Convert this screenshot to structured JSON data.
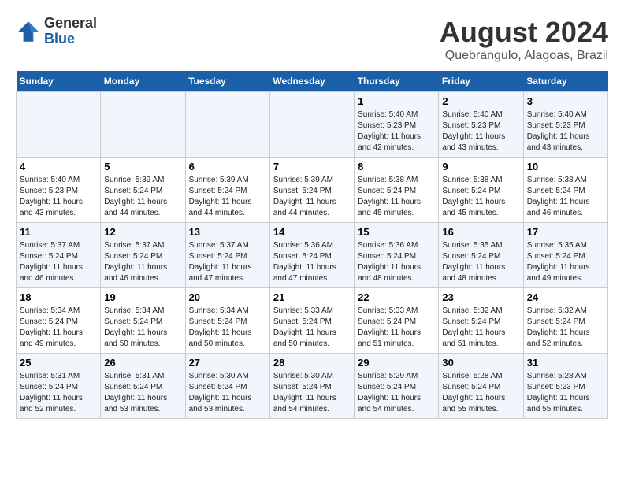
{
  "logo": {
    "general": "General",
    "blue": "Blue"
  },
  "title": "August 2024",
  "subtitle": "Quebrangulo, Alagoas, Brazil",
  "days_of_week": [
    "Sunday",
    "Monday",
    "Tuesday",
    "Wednesday",
    "Thursday",
    "Friday",
    "Saturday"
  ],
  "weeks": [
    [
      {
        "day": "",
        "info": ""
      },
      {
        "day": "",
        "info": ""
      },
      {
        "day": "",
        "info": ""
      },
      {
        "day": "",
        "info": ""
      },
      {
        "day": "1",
        "info": "Sunrise: 5:40 AM\nSunset: 5:23 PM\nDaylight: 11 hours\nand 42 minutes."
      },
      {
        "day": "2",
        "info": "Sunrise: 5:40 AM\nSunset: 5:23 PM\nDaylight: 11 hours\nand 43 minutes."
      },
      {
        "day": "3",
        "info": "Sunrise: 5:40 AM\nSunset: 5:23 PM\nDaylight: 11 hours\nand 43 minutes."
      }
    ],
    [
      {
        "day": "4",
        "info": "Sunrise: 5:40 AM\nSunset: 5:23 PM\nDaylight: 11 hours\nand 43 minutes."
      },
      {
        "day": "5",
        "info": "Sunrise: 5:39 AM\nSunset: 5:24 PM\nDaylight: 11 hours\nand 44 minutes."
      },
      {
        "day": "6",
        "info": "Sunrise: 5:39 AM\nSunset: 5:24 PM\nDaylight: 11 hours\nand 44 minutes."
      },
      {
        "day": "7",
        "info": "Sunrise: 5:39 AM\nSunset: 5:24 PM\nDaylight: 11 hours\nand 44 minutes."
      },
      {
        "day": "8",
        "info": "Sunrise: 5:38 AM\nSunset: 5:24 PM\nDaylight: 11 hours\nand 45 minutes."
      },
      {
        "day": "9",
        "info": "Sunrise: 5:38 AM\nSunset: 5:24 PM\nDaylight: 11 hours\nand 45 minutes."
      },
      {
        "day": "10",
        "info": "Sunrise: 5:38 AM\nSunset: 5:24 PM\nDaylight: 11 hours\nand 46 minutes."
      }
    ],
    [
      {
        "day": "11",
        "info": "Sunrise: 5:37 AM\nSunset: 5:24 PM\nDaylight: 11 hours\nand 46 minutes."
      },
      {
        "day": "12",
        "info": "Sunrise: 5:37 AM\nSunset: 5:24 PM\nDaylight: 11 hours\nand 46 minutes."
      },
      {
        "day": "13",
        "info": "Sunrise: 5:37 AM\nSunset: 5:24 PM\nDaylight: 11 hours\nand 47 minutes."
      },
      {
        "day": "14",
        "info": "Sunrise: 5:36 AM\nSunset: 5:24 PM\nDaylight: 11 hours\nand 47 minutes."
      },
      {
        "day": "15",
        "info": "Sunrise: 5:36 AM\nSunset: 5:24 PM\nDaylight: 11 hours\nand 48 minutes."
      },
      {
        "day": "16",
        "info": "Sunrise: 5:35 AM\nSunset: 5:24 PM\nDaylight: 11 hours\nand 48 minutes."
      },
      {
        "day": "17",
        "info": "Sunrise: 5:35 AM\nSunset: 5:24 PM\nDaylight: 11 hours\nand 49 minutes."
      }
    ],
    [
      {
        "day": "18",
        "info": "Sunrise: 5:34 AM\nSunset: 5:24 PM\nDaylight: 11 hours\nand 49 minutes."
      },
      {
        "day": "19",
        "info": "Sunrise: 5:34 AM\nSunset: 5:24 PM\nDaylight: 11 hours\nand 50 minutes."
      },
      {
        "day": "20",
        "info": "Sunrise: 5:34 AM\nSunset: 5:24 PM\nDaylight: 11 hours\nand 50 minutes."
      },
      {
        "day": "21",
        "info": "Sunrise: 5:33 AM\nSunset: 5:24 PM\nDaylight: 11 hours\nand 50 minutes."
      },
      {
        "day": "22",
        "info": "Sunrise: 5:33 AM\nSunset: 5:24 PM\nDaylight: 11 hours\nand 51 minutes."
      },
      {
        "day": "23",
        "info": "Sunrise: 5:32 AM\nSunset: 5:24 PM\nDaylight: 11 hours\nand 51 minutes."
      },
      {
        "day": "24",
        "info": "Sunrise: 5:32 AM\nSunset: 5:24 PM\nDaylight: 11 hours\nand 52 minutes."
      }
    ],
    [
      {
        "day": "25",
        "info": "Sunrise: 5:31 AM\nSunset: 5:24 PM\nDaylight: 11 hours\nand 52 minutes."
      },
      {
        "day": "26",
        "info": "Sunrise: 5:31 AM\nSunset: 5:24 PM\nDaylight: 11 hours\nand 53 minutes."
      },
      {
        "day": "27",
        "info": "Sunrise: 5:30 AM\nSunset: 5:24 PM\nDaylight: 11 hours\nand 53 minutes."
      },
      {
        "day": "28",
        "info": "Sunrise: 5:30 AM\nSunset: 5:24 PM\nDaylight: 11 hours\nand 54 minutes."
      },
      {
        "day": "29",
        "info": "Sunrise: 5:29 AM\nSunset: 5:24 PM\nDaylight: 11 hours\nand 54 minutes."
      },
      {
        "day": "30",
        "info": "Sunrise: 5:28 AM\nSunset: 5:24 PM\nDaylight: 11 hours\nand 55 minutes."
      },
      {
        "day": "31",
        "info": "Sunrise: 5:28 AM\nSunset: 5:23 PM\nDaylight: 11 hours\nand 55 minutes."
      }
    ]
  ]
}
